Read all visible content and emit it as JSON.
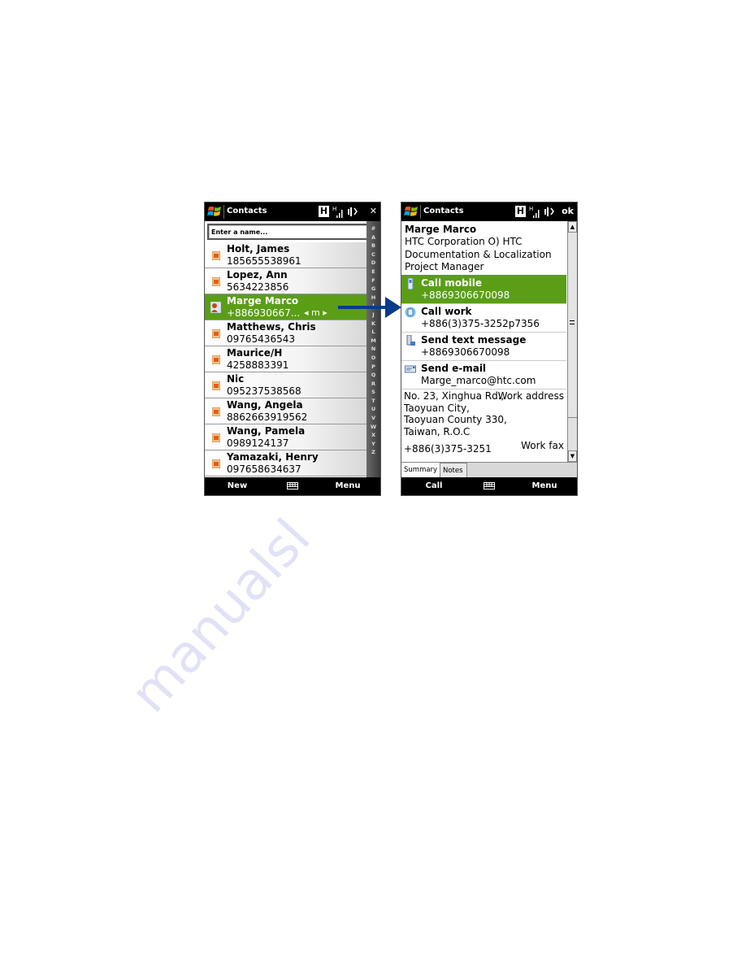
{
  "left_screen": {
    "title": "Contacts",
    "status_h": "H",
    "signal_label": "H",
    "close_label": "✕",
    "search": {
      "placeholder": "Enter a name...",
      "value": ""
    },
    "contacts": [
      {
        "name": "Holt, James",
        "number": "185655538961",
        "selected": false
      },
      {
        "name": "Lopez, Ann",
        "number": "5634223856",
        "selected": false
      },
      {
        "name": "Marge Marco",
        "number": "+886930667...",
        "selected": true,
        "mode": "◂ m ▸"
      },
      {
        "name": "Matthews, Chris",
        "number": "09765436543",
        "selected": false
      },
      {
        "name": "Maurice/H",
        "number": "4258883391",
        "selected": false
      },
      {
        "name": "Nic",
        "number": "095237538568",
        "selected": false
      },
      {
        "name": "Wang, Angela",
        "number": "8862663919562",
        "selected": false
      },
      {
        "name": "Wang, Pamela",
        "number": "0989124137",
        "selected": false
      },
      {
        "name": "Yamazaki, Henry",
        "number": "097658634637",
        "selected": false
      }
    ],
    "alphabet": [
      "#",
      "A",
      "B",
      "C",
      "D",
      "E",
      "F",
      "G",
      "H",
      "I",
      "J",
      "K",
      "L",
      "M",
      "N",
      "O",
      "P",
      "Q",
      "R",
      "S",
      "T",
      "U",
      "V",
      "W",
      "X",
      "Y",
      "Z"
    ],
    "softkeys": {
      "left": "New",
      "right": "Menu"
    }
  },
  "right_screen": {
    "title": "Contacts",
    "status_h": "H",
    "signal_label": "H",
    "ok_label": "ok",
    "contact": {
      "name": "Marge Marco",
      "company": "HTC Corporation O) HTC",
      "department": "Documentation & Localization",
      "job_title": "Project Manager"
    },
    "actions": [
      {
        "label": "Call mobile",
        "value": "+8869306670098",
        "icon": "mobile-phone-icon",
        "selected": true
      },
      {
        "label": "Call work",
        "value": "+886(3)375-3252p7356",
        "icon": "work-phone-icon",
        "selected": false
      },
      {
        "label": "Send text message",
        "value": "+8869306670098",
        "icon": "sms-icon",
        "selected": false
      },
      {
        "label": "Send e-mail",
        "value": "Marge_marco@htc.com",
        "icon": "email-icon",
        "selected": false
      }
    ],
    "address": {
      "lines": [
        "No. 23, Xinghua Rd.,",
        "Taoyuan City,",
        "Taoyuan County 330,",
        "Taiwan, R.O.C"
      ],
      "type": "Work address"
    },
    "fax": {
      "number": "+886(3)375-3251",
      "type": "Work fax"
    },
    "tabs": [
      {
        "label": "Summary",
        "active": true
      },
      {
        "label": "Notes",
        "active": false
      }
    ],
    "softkeys": {
      "left": "Call",
      "right": "Menu"
    }
  },
  "colors": {
    "highlight": "#5a9e16",
    "titlebar": "#000000",
    "arrow": "#0a3a8c"
  },
  "watermark": "manualsl"
}
